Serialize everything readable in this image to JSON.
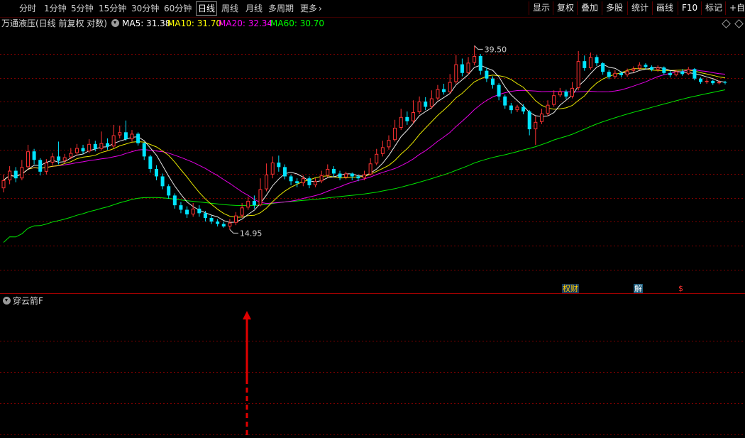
{
  "toolbar": {
    "periods": [
      "分时",
      "1分钟",
      "5分钟",
      "15分钟",
      "30分钟",
      "60分钟",
      "日线",
      "周线",
      "月线",
      "多周期",
      "更多"
    ],
    "active_period": "日线",
    "more_arrow": "›",
    "right_buttons": [
      "显示",
      "复权",
      "叠加",
      "多股",
      "统计",
      "画线",
      "F10",
      "标记",
      "+自选"
    ]
  },
  "info": {
    "title": "万通液压(日线 前复权 对数)",
    "ma5": "MA5: 31.38",
    "ma10": "MA10: 31.70",
    "ma20": "MA20: 32.34",
    "ma60": "MA60: 30.70"
  },
  "colors": {
    "up": "#ff3232",
    "down": "#00e4ff",
    "ma5": "#ffffff",
    "ma10": "#ffff00",
    "ma20": "#ff00ff",
    "ma60": "#00ff00",
    "grid": "#7a0000",
    "divider": "#a00000",
    "arrow": "#e00000"
  },
  "annotations": {
    "high_label": "39.50",
    "low_label": "14.95"
  },
  "events": [
    "权财",
    "解",
    "$"
  ],
  "indicator": {
    "name": "穿云箭F"
  },
  "chart_data": {
    "type": "candlestick",
    "title": "万通液压",
    "scale": "log",
    "ylim": [
      12.0,
      42.0
    ],
    "high": 39.5,
    "low": 14.95,
    "ma_latest": {
      "MA5": 31.38,
      "MA10": 31.7,
      "MA20": 32.34,
      "MA60": 30.7
    },
    "candles": [
      [
        18.6,
        19.4,
        20.0,
        18.2
      ],
      [
        19.4,
        20.4,
        20.9,
        19.0
      ],
      [
        20.4,
        19.6,
        20.8,
        19.2
      ],
      [
        19.6,
        20.8,
        21.6,
        19.4
      ],
      [
        20.8,
        22.6,
        23.4,
        20.6
      ],
      [
        22.6,
        21.6,
        22.9,
        21.1
      ],
      [
        21.6,
        20.3,
        21.8,
        19.9
      ],
      [
        20.3,
        21.3,
        21.7,
        20.0
      ],
      [
        21.3,
        22.0,
        22.4,
        21.0
      ],
      [
        22.0,
        21.5,
        23.8,
        21.1
      ],
      [
        21.5,
        21.9,
        22.3,
        21.2
      ],
      [
        21.9,
        22.4,
        23.0,
        21.7
      ],
      [
        22.4,
        23.0,
        23.5,
        22.1
      ],
      [
        23.0,
        22.6,
        23.4,
        22.3
      ],
      [
        22.6,
        23.5,
        24.1,
        22.4
      ],
      [
        23.5,
        22.9,
        23.9,
        22.6
      ],
      [
        22.9,
        23.6,
        25.1,
        22.7
      ],
      [
        23.6,
        23.2,
        24.2,
        22.8
      ],
      [
        23.2,
        24.6,
        26.0,
        23.0
      ],
      [
        24.6,
        25.0,
        25.9,
        24.2
      ],
      [
        25.0,
        24.1,
        26.6,
        23.9
      ],
      [
        24.1,
        24.8,
        25.3,
        23.8
      ],
      [
        24.8,
        23.6,
        25.0,
        23.3
      ],
      [
        23.6,
        22.0,
        23.7,
        21.6
      ],
      [
        22.0,
        20.6,
        22.2,
        20.2
      ],
      [
        20.6,
        19.8,
        21.0,
        19.4
      ],
      [
        19.8,
        18.8,
        20.1,
        18.5
      ],
      [
        18.8,
        17.9,
        19.0,
        17.6
      ],
      [
        17.9,
        17.0,
        18.1,
        16.7
      ],
      [
        17.0,
        16.6,
        17.3,
        16.3
      ],
      [
        16.6,
        16.2,
        16.9,
        15.9
      ],
      [
        16.2,
        16.7,
        17.2,
        16.0
      ],
      [
        16.7,
        16.3,
        17.0,
        16.0
      ],
      [
        16.3,
        15.9,
        16.5,
        15.6
      ],
      [
        15.9,
        15.6,
        16.1,
        15.4
      ],
      [
        15.6,
        15.4,
        15.8,
        15.2
      ],
      [
        15.4,
        15.2,
        15.6,
        15.1
      ],
      [
        15.2,
        15.5,
        15.8,
        14.95
      ],
      [
        15.5,
        16.1,
        16.4,
        15.3
      ],
      [
        16.1,
        16.8,
        17.2,
        15.9
      ],
      [
        16.8,
        17.4,
        17.8,
        16.6
      ],
      [
        17.4,
        17.0,
        17.9,
        16.7
      ],
      [
        17.0,
        18.5,
        19.6,
        16.9
      ],
      [
        18.5,
        20.0,
        21.2,
        18.3
      ],
      [
        20.0,
        21.3,
        22.0,
        19.6
      ],
      [
        21.3,
        20.8,
        22.1,
        20.3
      ],
      [
        20.8,
        19.8,
        21.1,
        19.5
      ],
      [
        19.8,
        19.3,
        20.0,
        18.9
      ],
      [
        19.3,
        19.1,
        19.6,
        18.7
      ],
      [
        19.1,
        19.6,
        19.9,
        18.8
      ],
      [
        19.6,
        18.9,
        19.8,
        18.6
      ],
      [
        18.9,
        19.3,
        19.6,
        18.7
      ],
      [
        19.3,
        19.9,
        20.4,
        19.1
      ],
      [
        19.9,
        20.6,
        21.1,
        19.7
      ],
      [
        20.6,
        20.1,
        20.9,
        19.8
      ],
      [
        20.1,
        19.7,
        20.4,
        19.4
      ],
      [
        19.7,
        20.1,
        20.3,
        19.5
      ],
      [
        20.1,
        19.8,
        20.2,
        19.4
      ],
      [
        19.8,
        19.6,
        20.0,
        19.3
      ],
      [
        19.6,
        20.0,
        20.4,
        19.4
      ],
      [
        20.0,
        21.2,
        21.8,
        19.9
      ],
      [
        21.2,
        22.3,
        22.9,
        21.0
      ],
      [
        22.3,
        23.1,
        23.9,
        22.0
      ],
      [
        23.1,
        24.0,
        24.6,
        22.8
      ],
      [
        24.0,
        25.6,
        26.7,
        23.8
      ],
      [
        25.6,
        27.1,
        28.3,
        25.3
      ],
      [
        27.1,
        26.5,
        27.9,
        26.0
      ],
      [
        26.5,
        27.8,
        29.6,
        26.2
      ],
      [
        27.8,
        29.4,
        30.2,
        27.5
      ],
      [
        29.4,
        28.6,
        30.1,
        28.1
      ],
      [
        28.6,
        29.9,
        31.2,
        28.3
      ],
      [
        29.9,
        31.4,
        32.1,
        29.6
      ],
      [
        31.4,
        30.9,
        32.3,
        30.5
      ],
      [
        30.9,
        32.6,
        34.0,
        30.7
      ],
      [
        32.6,
        35.8,
        37.6,
        32.3
      ],
      [
        35.8,
        34.2,
        36.9,
        33.6
      ],
      [
        34.2,
        36.1,
        37.2,
        33.9
      ],
      [
        36.1,
        37.4,
        39.5,
        35.6
      ],
      [
        37.4,
        34.6,
        37.8,
        33.9
      ],
      [
        34.6,
        33.2,
        35.2,
        32.6
      ],
      [
        33.2,
        32.1,
        33.6,
        31.5
      ],
      [
        32.1,
        30.2,
        32.4,
        29.6
      ],
      [
        30.2,
        28.8,
        30.5,
        28.3
      ],
      [
        28.8,
        28.1,
        29.2,
        27.6
      ],
      [
        28.1,
        28.6,
        28.9,
        27.8
      ],
      [
        28.6,
        27.9,
        29.0,
        27.5
      ],
      [
        27.9,
        25.4,
        28.1,
        24.6
      ],
      [
        25.4,
        26.4,
        27.2,
        23.4
      ],
      [
        26.4,
        27.6,
        28.3,
        26.1
      ],
      [
        27.6,
        28.9,
        29.6,
        27.2
      ],
      [
        28.9,
        30.4,
        31.2,
        28.6
      ],
      [
        30.4,
        31.0,
        31.6,
        30.1
      ],
      [
        31.0,
        30.2,
        31.3,
        29.8
      ],
      [
        30.2,
        31.6,
        32.6,
        29.9
      ],
      [
        31.6,
        36.4,
        38.4,
        31.2
      ],
      [
        36.4,
        35.1,
        37.5,
        34.6
      ],
      [
        35.1,
        37.2,
        38.1,
        34.8
      ],
      [
        37.2,
        36.0,
        37.6,
        35.5
      ],
      [
        36.0,
        34.4,
        36.2,
        33.9
      ],
      [
        34.4,
        33.5,
        34.8,
        33.1
      ],
      [
        33.5,
        34.2,
        34.7,
        33.2
      ],
      [
        34.2,
        33.8,
        34.5,
        33.4
      ],
      [
        33.8,
        34.6,
        35.0,
        33.5
      ],
      [
        34.6,
        35.0,
        35.4,
        34.3
      ],
      [
        35.0,
        35.7,
        36.2,
        34.7
      ],
      [
        35.7,
        35.3,
        36.0,
        34.9
      ],
      [
        35.3,
        34.8,
        35.6,
        34.5
      ],
      [
        34.8,
        35.2,
        35.6,
        34.4
      ],
      [
        35.2,
        34.2,
        35.4,
        33.9
      ],
      [
        34.2,
        33.8,
        34.6,
        33.4
      ],
      [
        33.8,
        34.5,
        34.8,
        33.6
      ],
      [
        34.5,
        34.0,
        34.9,
        33.7
      ],
      [
        34.0,
        34.9,
        35.3,
        33.8
      ],
      [
        34.9,
        33.2,
        35.1,
        32.9
      ],
      [
        33.2,
        32.6,
        33.4,
        32.3
      ],
      [
        32.6,
        32.8,
        33.1,
        32.3
      ],
      [
        32.8,
        32.4,
        33.0,
        32.1
      ],
      [
        32.4,
        32.6,
        32.9,
        32.2
      ],
      [
        32.6,
        32.5,
        32.8,
        32.2
      ]
    ]
  }
}
